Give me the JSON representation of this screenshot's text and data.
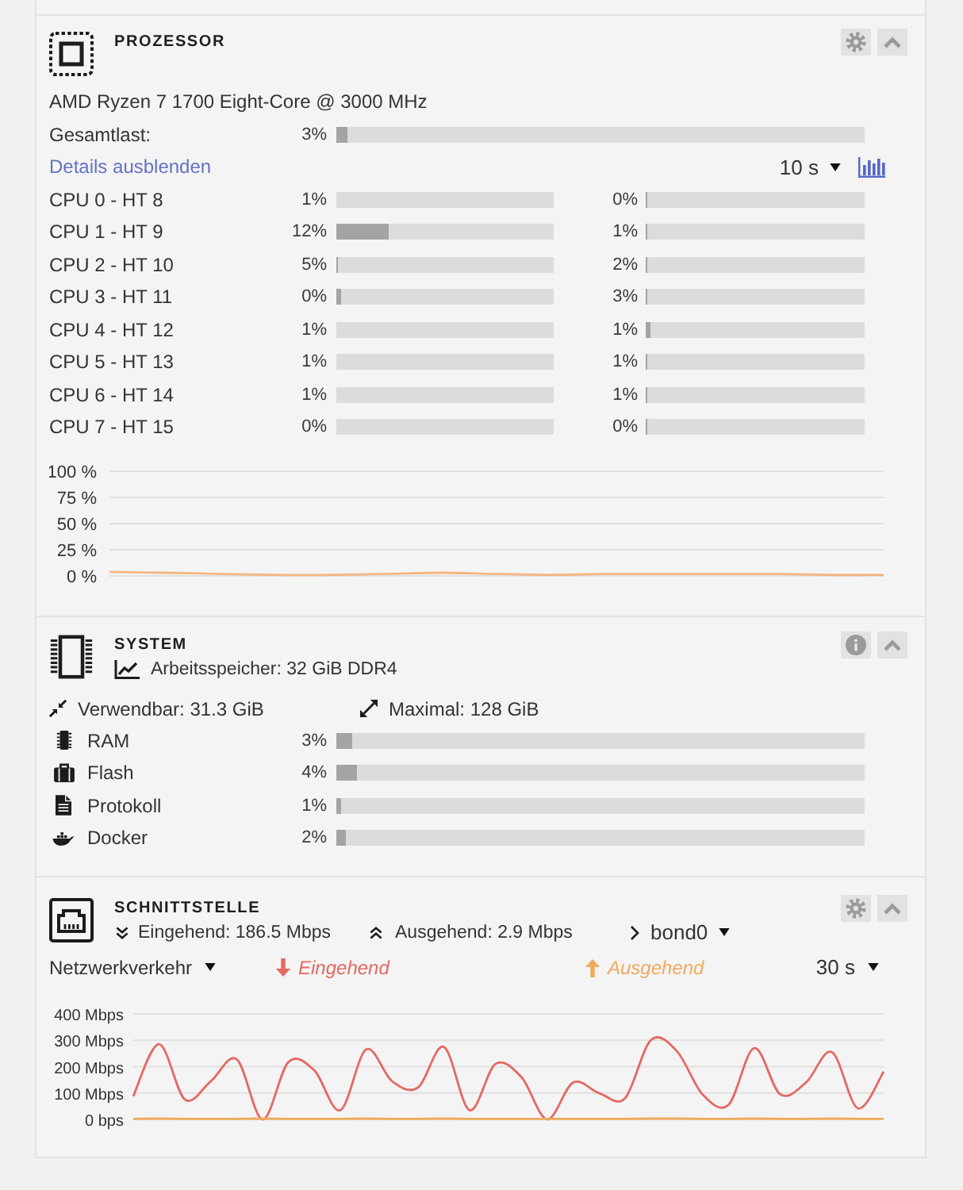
{
  "processor": {
    "title": "PROZESSOR",
    "header_buttons": [
      {
        "kind": "settings"
      },
      {
        "kind": "collapse"
      }
    ],
    "model": "AMD Ryzen 7 1700 Eight-Core @ 3000 MHz",
    "total": {
      "label": "Gesamtlast:",
      "percent": "3%",
      "level": 0.02
    },
    "details_link": "Details ausblenden",
    "interval": "10 s",
    "cores": [
      {
        "label": "CPU 0 - HT 8",
        "load": {
          "percent": "1%",
          "level": 0
        },
        "ht_load": {
          "percent": "0%",
          "level": 0.008
        }
      },
      {
        "label": "CPU 1 - HT 9",
        "load": {
          "percent": "12%",
          "level": 0.24
        },
        "ht_load": {
          "percent": "1%",
          "level": 0.008
        }
      },
      {
        "label": "CPU 2 - HT 10",
        "load": {
          "percent": "5%",
          "level": 0.008
        },
        "ht_load": {
          "percent": "2%",
          "level": 0.008
        }
      },
      {
        "label": "CPU 3 - HT 11",
        "load": {
          "percent": "0%",
          "level": 0.02
        },
        "ht_load": {
          "percent": "3%",
          "level": 0.008
        }
      },
      {
        "label": "CPU 4 - HT 12",
        "load": {
          "percent": "1%",
          "level": 0
        },
        "ht_load": {
          "percent": "1%",
          "level": 0.02
        }
      },
      {
        "label": "CPU 5 - HT 13",
        "load": {
          "percent": "1%",
          "level": 0
        },
        "ht_load": {
          "percent": "1%",
          "level": 0.008
        }
      },
      {
        "label": "CPU 6 - HT 14",
        "load": {
          "percent": "1%",
          "level": 0
        },
        "ht_load": {
          "percent": "1%",
          "level": 0.008
        }
      },
      {
        "label": "CPU 7 - HT 15",
        "load": {
          "percent": "0%",
          "level": 0
        },
        "ht_load": {
          "percent": "0%",
          "level": 0.008
        }
      }
    ],
    "chart_data": {
      "type": "line",
      "grid": true,
      "ylim": [
        0,
        100
      ],
      "yticks": [
        {
          "value": 0,
          "label": "0 %"
        },
        {
          "value": 25,
          "label": "25 %"
        },
        {
          "value": 50,
          "label": "50 %"
        },
        {
          "value": 75,
          "label": "75 %"
        },
        {
          "value": 100,
          "label": "100 %"
        }
      ],
      "series": [
        {
          "color": "#f5b580",
          "values": [
            4,
            3,
            2,
            1,
            1,
            2,
            3,
            2,
            1,
            2,
            2,
            2,
            2,
            1,
            1
          ]
        }
      ]
    }
  },
  "system": {
    "title": "SYSTEM",
    "header_buttons": [
      {
        "kind": "info"
      },
      {
        "kind": "collapse"
      }
    ],
    "memory": "Arbeitsspeicher: 32 GiB DDR4",
    "usable": "Verwendbar: 31.3 GiB",
    "maximum": "Maximal: 128 GiB",
    "usage": [
      {
        "kind": "ram",
        "label": "RAM",
        "percent": "3%",
        "level": 0.03
      },
      {
        "kind": "flash",
        "label": "Flash",
        "percent": "4%",
        "level": 0.04
      },
      {
        "kind": "log",
        "label": "Protokoll",
        "percent": "1%",
        "level": 0.01
      },
      {
        "kind": "docker",
        "label": "Docker",
        "percent": "2%",
        "level": 0.019
      }
    ]
  },
  "interface": {
    "title": "SCHNITTSTELLE",
    "header_buttons": [
      {
        "kind": "settings"
      },
      {
        "kind": "collapse"
      }
    ],
    "inbound": "Eingehend: 186.5 Mbps",
    "outbound": "Ausgehend: 2.9 Mbps",
    "port": "bond0",
    "view": "Netzwerkverkehr",
    "interval": "30 s",
    "chart_data": {
      "type": "line",
      "grid": true,
      "ylim": [
        0,
        400
      ],
      "yticks": [
        {
          "value": 0,
          "label": "0 bps"
        },
        {
          "value": 100,
          "label": "100 Mbps"
        },
        {
          "value": 200,
          "label": "200 Mbps"
        },
        {
          "value": 300,
          "label": "300 Mbps"
        },
        {
          "value": 400,
          "label": "400 Mbps"
        }
      ],
      "series": [
        {
          "name": "Eingehend",
          "color": "#e36a62",
          "values": [
            88,
            285,
            75,
            145,
            228,
            0,
            218,
            185,
            35,
            265,
            145,
            120,
            275,
            35,
            210,
            160,
            0,
            140,
            100,
            80,
            300,
            260,
            95,
            55,
            270,
            95,
            140,
            255,
            42,
            181
          ]
        },
        {
          "name": "Ausgehend",
          "color": "#f0aa5e",
          "values": [
            2,
            3,
            2,
            2,
            2,
            3,
            2,
            2,
            2,
            3,
            2,
            2,
            3,
            2,
            2,
            2,
            2,
            2,
            2,
            2,
            3,
            3,
            2,
            2,
            3,
            2,
            2,
            3,
            2,
            2
          ]
        }
      ]
    }
  }
}
